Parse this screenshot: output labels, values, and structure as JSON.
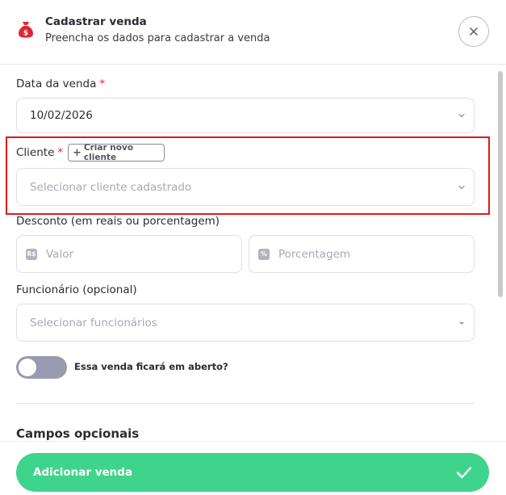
{
  "header": {
    "title": "Cadastrar venda",
    "subtitle": "Preencha os dados para cadastrar a venda",
    "icon": "money-bag-icon",
    "icon_color": "#e0252f",
    "close_icon": "close-icon"
  },
  "form": {
    "sale_date": {
      "label": "Data da venda",
      "required_mark": "*",
      "value": "10/02/2026"
    },
    "client": {
      "label": "Cliente",
      "required_mark": "*",
      "create_button_label": "Criar novo cliente",
      "placeholder": "Selecionar cliente cadastrado",
      "highlight_color": "#dd1a1a"
    },
    "discount": {
      "label": "Desconto (em reais ou porcentagem)",
      "value_badge": "R$",
      "value_placeholder": "Valor",
      "percent_badge": "%",
      "percent_placeholder": "Porcentagem"
    },
    "employee": {
      "label": "Funcionário (opcional)",
      "placeholder": "Selecionar funcionários"
    },
    "open_sale_toggle": {
      "label": "Essa venda ficará em aberto?",
      "checked": false
    },
    "optional_section_title": "Campos opcionais"
  },
  "footer": {
    "submit_label": "Adicionar venda",
    "submit_color": "#3fd48b",
    "submit_icon": "check-icon"
  }
}
